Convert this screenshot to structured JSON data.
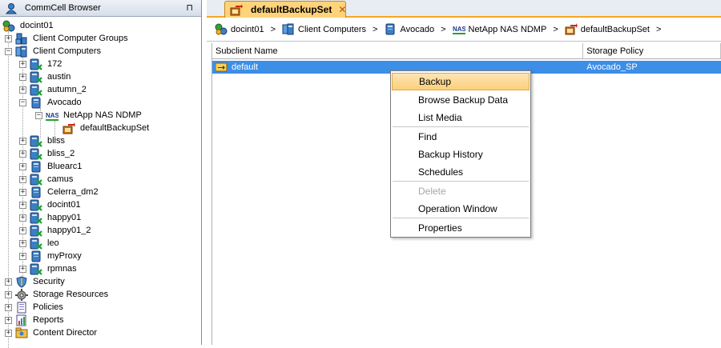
{
  "left_panel": {
    "title": "CommCell Browser",
    "pin_icon": "⊓",
    "tree": {
      "root": "docint01",
      "items": [
        {
          "label": "Client Computer Groups"
        },
        {
          "label": "Client Computers"
        },
        {
          "label": "172"
        },
        {
          "label": "austin"
        },
        {
          "label": "autumn_2"
        },
        {
          "label": "Avocado"
        },
        {
          "label": "NetApp NAS NDMP"
        },
        {
          "label": "defaultBackupSet"
        },
        {
          "label": "bliss"
        },
        {
          "label": "bliss_2"
        },
        {
          "label": "Bluearc1"
        },
        {
          "label": "camus"
        },
        {
          "label": "Celerra_dm2"
        },
        {
          "label": "docint01"
        },
        {
          "label": "happy01"
        },
        {
          "label": "happy01_2"
        },
        {
          "label": "leo"
        },
        {
          "label": "myProxy"
        },
        {
          "label": "rpmnas"
        },
        {
          "label": "Security"
        },
        {
          "label": "Storage Resources"
        },
        {
          "label": "Policies"
        },
        {
          "label": "Reports"
        },
        {
          "label": "Content Director"
        }
      ]
    }
  },
  "tab": {
    "label": "defaultBackupSet",
    "close": "✕"
  },
  "breadcrumb": [
    "docint01",
    "Client Computers",
    "Avocado",
    "NetApp NAS NDMP",
    "defaultBackupSet"
  ],
  "breadcrumb_sep": ">",
  "nas_label": "NAS",
  "table": {
    "columns": [
      "Subclient Name",
      "Storage Policy"
    ],
    "rows": [
      {
        "name": "default",
        "policy": "Avocado_SP"
      }
    ]
  },
  "context_menu": [
    {
      "label": "Backup"
    },
    {
      "label": "Browse Backup Data"
    },
    {
      "label": "List Media"
    },
    {
      "label": "Find"
    },
    {
      "label": "Backup History"
    },
    {
      "label": "Schedules"
    },
    {
      "label": "Delete"
    },
    {
      "label": "Operation Window"
    },
    {
      "label": "Properties"
    }
  ],
  "colors": {
    "selection": "#3d8ee6",
    "tab": "#ffd37a",
    "menu_highlight": "#fbd079",
    "accent": "#f5a623"
  }
}
